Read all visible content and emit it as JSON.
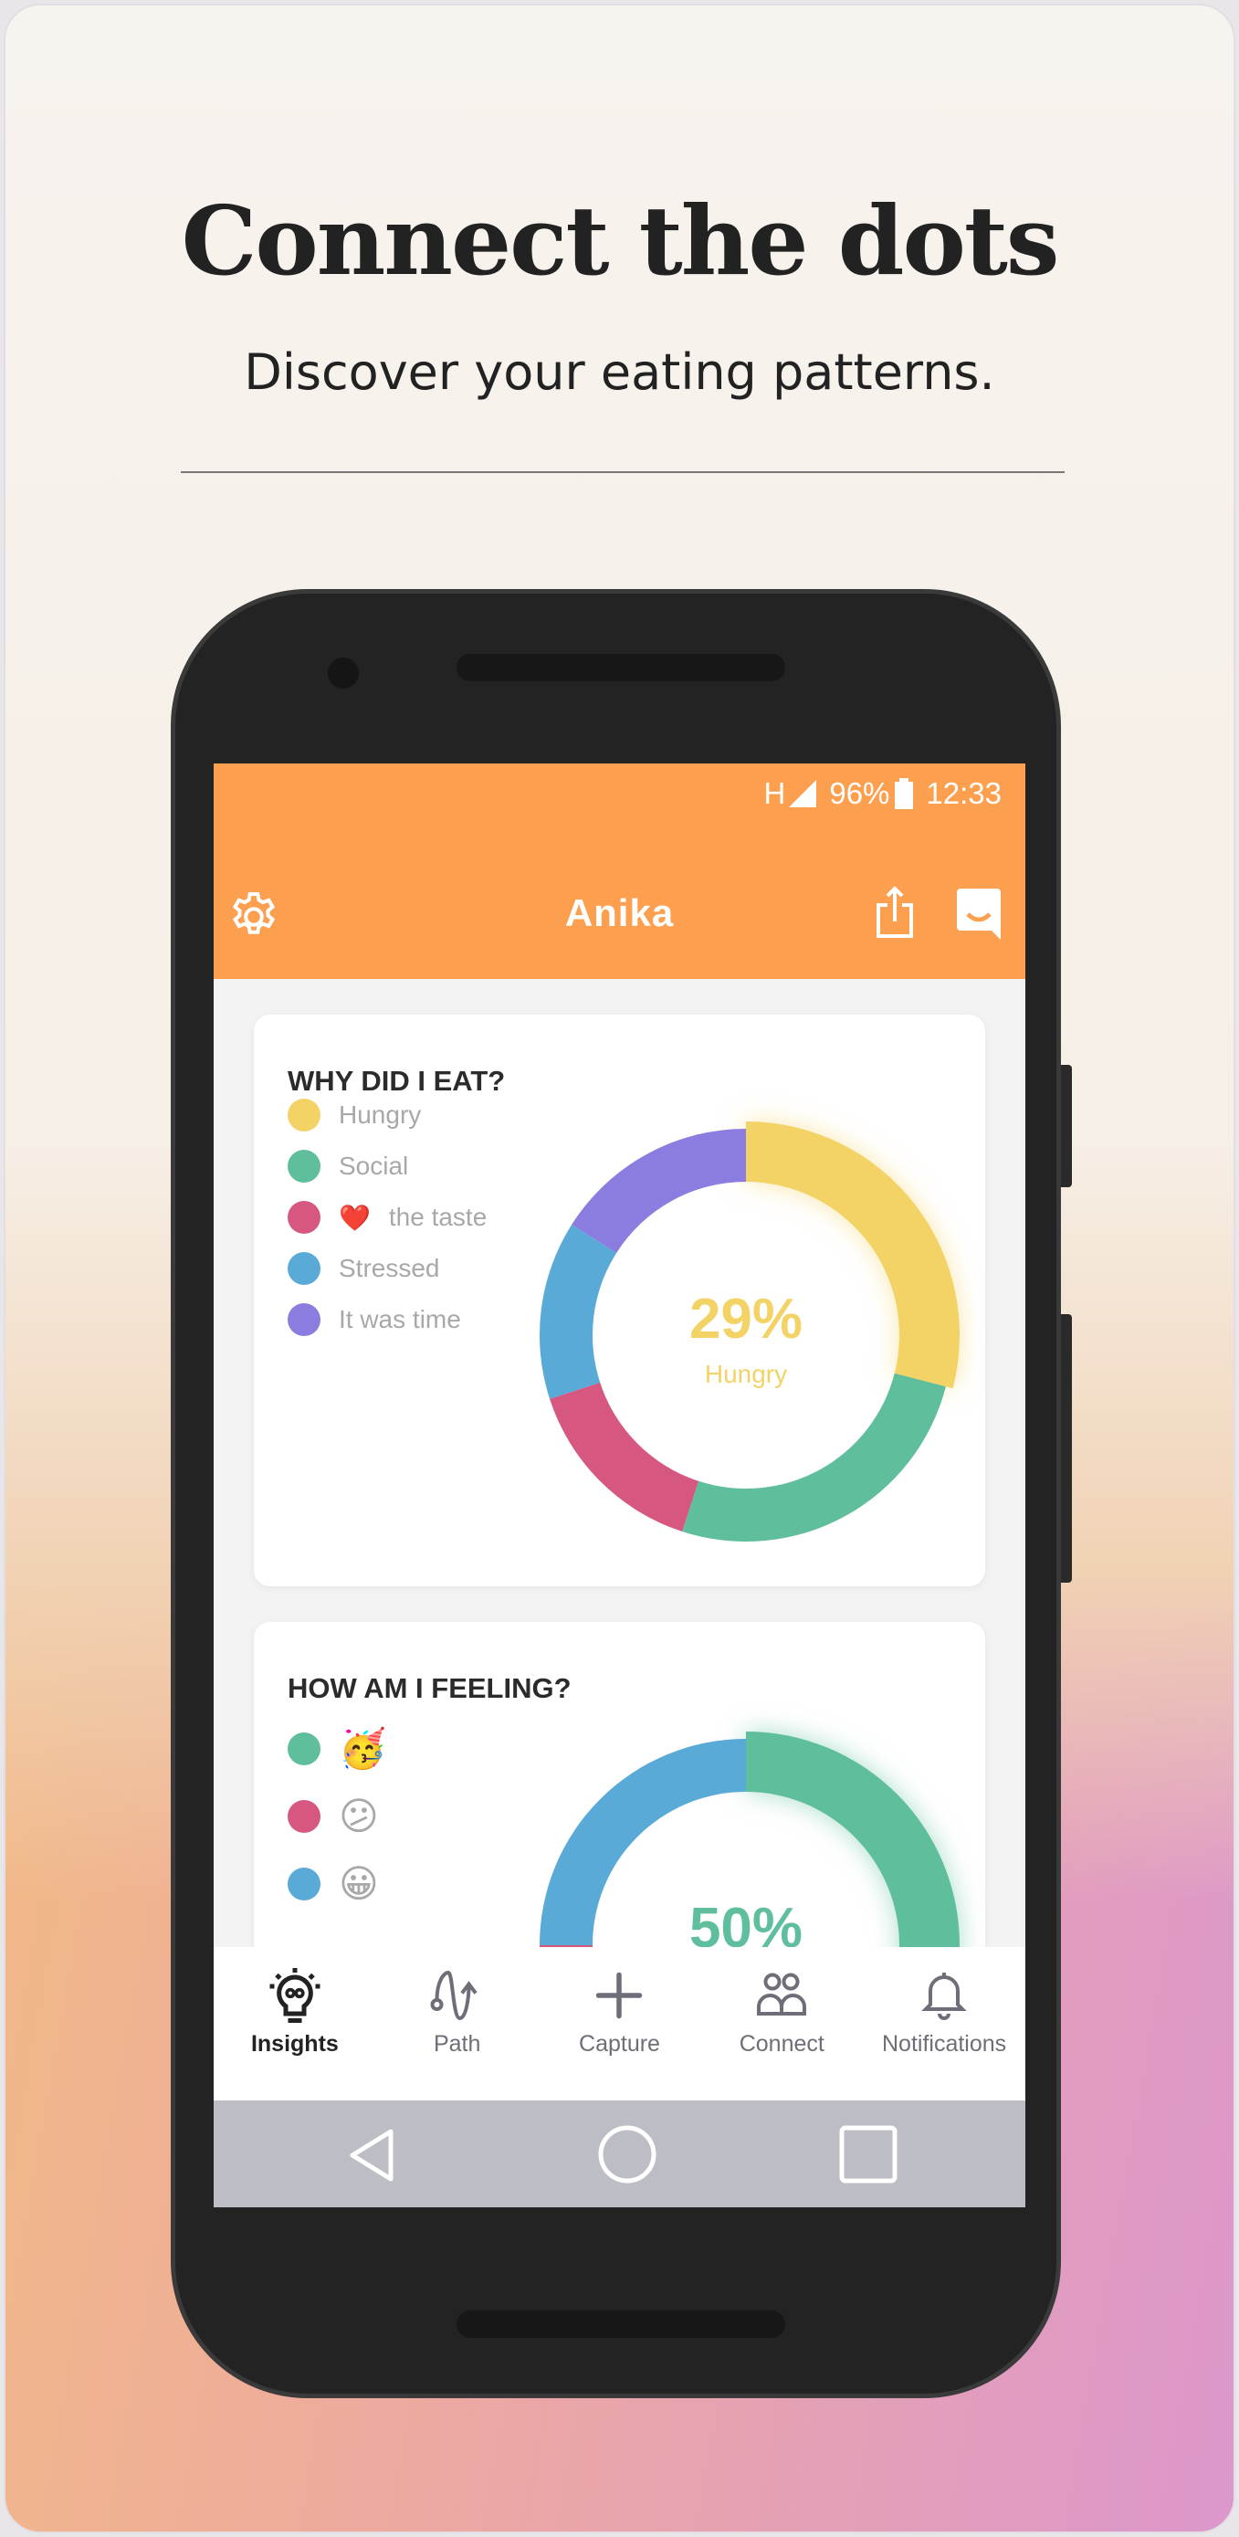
{
  "headline": "Connect the dots",
  "subtitle": "Discover your eating patterns.",
  "status": {
    "network": "H",
    "battery": "96%",
    "time": "12:33"
  },
  "app": {
    "title": "Anika"
  },
  "colors": {
    "appbar": "#fca050",
    "yellow": "#f3d366",
    "green": "#5fbf9c",
    "pink": "#d6577f",
    "blue": "#5aaad8",
    "purple": "#8b7ce0"
  },
  "cards": [
    {
      "title": "WHY DID I EAT?",
      "legend": [
        {
          "label": "Hungry",
          "color": "#f3d366"
        },
        {
          "label": "Social",
          "color": "#5fbf9c"
        },
        {
          "emoji": "❤️",
          "label": "the taste",
          "color": "#d6577f"
        },
        {
          "label": "Stressed",
          "color": "#5aaad8"
        },
        {
          "label": "It was time",
          "color": "#8b7ce0"
        }
      ],
      "center_value": "29%",
      "center_label": "Hungry"
    },
    {
      "title": "HOW AM I FEELING?",
      "legend": [
        {
          "emoji": "🥳",
          "color": "#5fbf9c"
        },
        {
          "emoji": "😕",
          "color": "#d6577f"
        },
        {
          "emoji": "😀",
          "color": "#5aaad8"
        }
      ],
      "center_value": "50%"
    }
  ],
  "chart_data": [
    {
      "type": "pie",
      "donut": true,
      "categories": [
        "Hungry",
        "Social",
        "❤️ the taste",
        "Stressed",
        "It was time"
      ],
      "values": [
        29,
        26,
        15,
        14,
        16
      ],
      "colors": [
        "#f3d366",
        "#5fbf9c",
        "#d6577f",
        "#5aaad8",
        "#8b7ce0"
      ],
      "highlight": "Hungry"
    },
    {
      "type": "pie",
      "donut": true,
      "categories": [
        "🥳",
        "😕",
        "😀"
      ],
      "values": [
        50,
        25,
        25
      ],
      "colors": [
        "#5fbf9c",
        "#d6577f",
        "#5aaad8"
      ],
      "highlight": "🥳"
    }
  ],
  "nav": [
    {
      "label": "Insights",
      "icon": "lightbulb-icon",
      "active": true
    },
    {
      "label": "Path",
      "icon": "path-icon"
    },
    {
      "label": "Capture",
      "icon": "plus-icon"
    },
    {
      "label": "Connect",
      "icon": "people-icon"
    },
    {
      "label": "Notifications",
      "icon": "bell-icon"
    }
  ]
}
